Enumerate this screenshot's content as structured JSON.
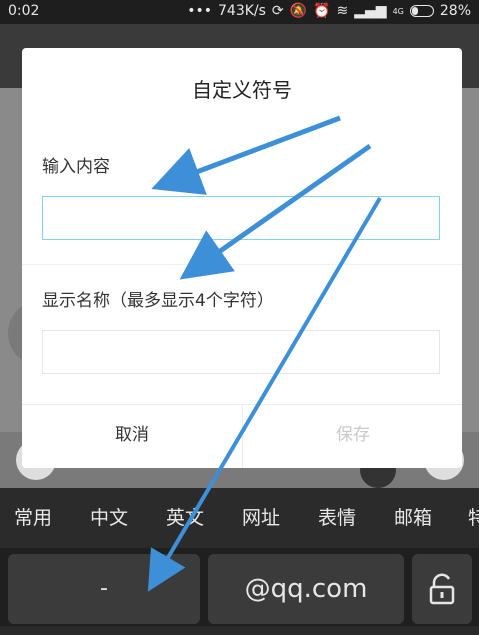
{
  "status_bar": {
    "time": "0:02",
    "dots": "•••",
    "net_speed": "743K/s",
    "network_badge": "4G",
    "battery": "28%"
  },
  "dialog": {
    "title": "自定义符号",
    "input_content_label": "输入内容",
    "input_content_value": "",
    "display_name_label": "显示名称（最多显示4个字符）",
    "display_name_value": "",
    "cancel_label": "取消",
    "save_label": "保存"
  },
  "categories": [
    "常用",
    "中文",
    "英文",
    "网址",
    "表情",
    "邮箱",
    "特"
  ],
  "keys": {
    "dash": "-",
    "qq": "@qq.com"
  },
  "colors": {
    "annotation_arrow": "#3d8fd8",
    "focused_input_border": "#7fd4e6",
    "save_disabled": "#c8c8c8"
  },
  "icons": {
    "lock": "unlock-icon",
    "float_ball": "assistive-touch-icon"
  }
}
